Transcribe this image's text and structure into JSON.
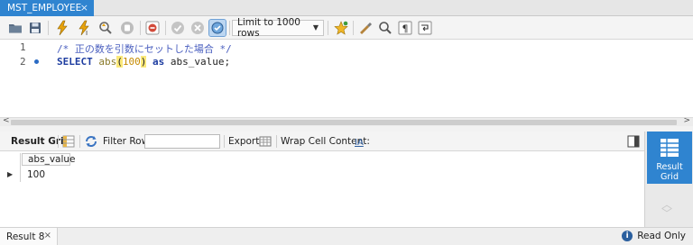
{
  "tab": {
    "title": "MST_EMPLOYEE",
    "close": "×"
  },
  "toolbar": {
    "limit_value": "Limit to 1000 rows",
    "icons": [
      "open-folder-icon",
      "save-icon",
      "execute-icon",
      "execute-statement-icon",
      "explain-icon",
      "stop-icon",
      "toggle-error-icon",
      "commit-icon",
      "rollback-icon",
      "autocommit-icon",
      "limit-select",
      "bookmark-icon",
      "beautify-icon",
      "find-icon",
      "invisible-chars-icon",
      "wrap-icon"
    ]
  },
  "editor": {
    "lines": [
      {
        "num": "1",
        "text": "/* 正の数を引数にセットした場合 */"
      },
      {
        "num": "2",
        "kw1": "SELECT",
        "fn": "abs",
        "p1": "(",
        "num_arg": "100",
        "p2": ")",
        "kw2": "as",
        "alias": "abs_value;"
      }
    ]
  },
  "result_toolbar": {
    "result_grid": "Result Grid",
    "filter_rows": "Filter Rows:",
    "filter_value": "",
    "export": "Export:",
    "wrap": "Wrap Cell Content:",
    "wrap_icon_glyph": "IA"
  },
  "grid": {
    "columns": [
      "abs_value"
    ],
    "rows": [
      [
        "100"
      ]
    ]
  },
  "side": {
    "label_line1": "Result",
    "label_line2": "Grid"
  },
  "bottom": {
    "result_tab": "Result 8",
    "close": "×",
    "status": "Read Only",
    "info_glyph": "i"
  },
  "colors": {
    "accent": "#2f84d0",
    "keyword": "#1e3da0",
    "comment": "#4a5fbf",
    "number": "#c58a00",
    "highlight": "#fbe97a"
  }
}
